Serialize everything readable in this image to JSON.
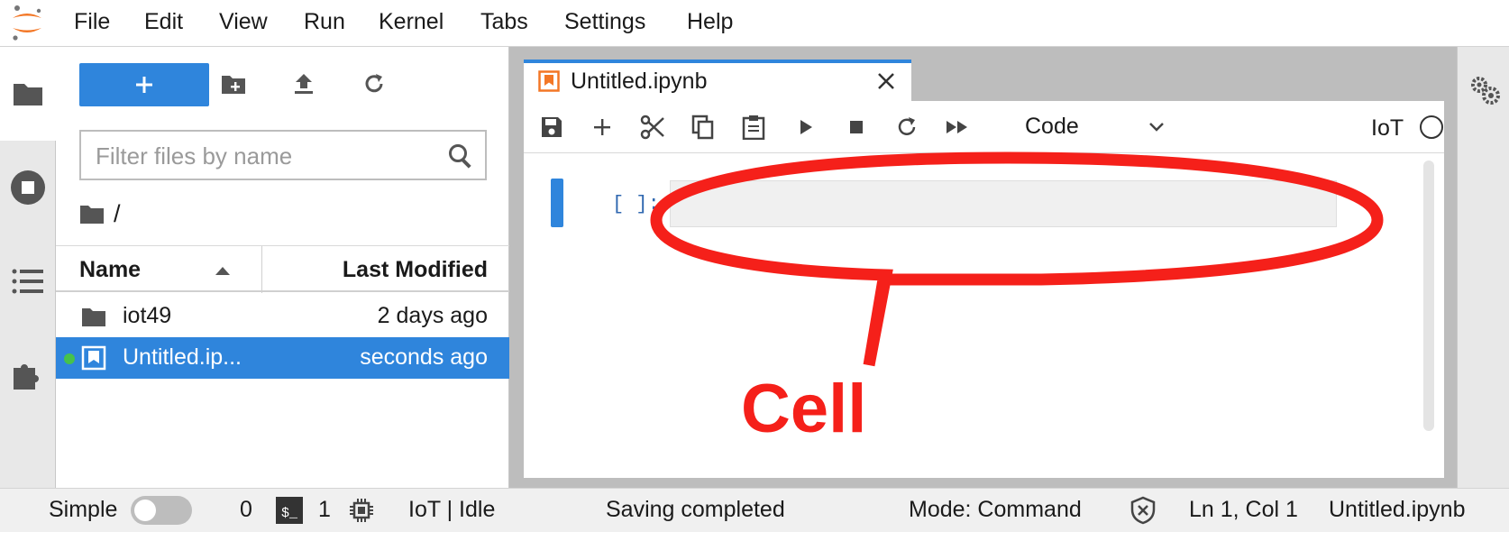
{
  "menubar": {
    "items": [
      "File",
      "Edit",
      "View",
      "Run",
      "Kernel",
      "Tabs",
      "Settings",
      "Help"
    ]
  },
  "filebrowser": {
    "new_button_label": "+",
    "filter_placeholder": "Filter files by name",
    "breadcrumb": "/",
    "columns": {
      "name": "Name",
      "modified": "Last Modified"
    },
    "files": [
      {
        "name": "iot49",
        "modified": "2 days ago",
        "type": "folder",
        "selected": false,
        "running": false
      },
      {
        "name": "Untitled.ip...",
        "modified": "seconds ago",
        "type": "notebook",
        "selected": true,
        "running": true
      }
    ]
  },
  "notebook": {
    "tab_title": "Untitled.ipynb",
    "cell_type": "Code",
    "kernel_name": "IoT",
    "cell_prompt": "[ ]:"
  },
  "annotation": {
    "label": "Cell",
    "color": "#f5201a"
  },
  "statusbar": {
    "simple_label": "Simple",
    "terminal_count": "0",
    "terminal_icon_text": "$_",
    "kernel_count": "1",
    "kernel_status": "IoT | Idle",
    "save_status": "Saving completed",
    "mode": "Mode: Command",
    "cursor_pos": "Ln 1, Col 1",
    "file_name": "Untitled.ipynb"
  },
  "colors": {
    "accent": "#2f85dc",
    "running": "#46c24b",
    "jupyter_orange": "#f37726"
  }
}
